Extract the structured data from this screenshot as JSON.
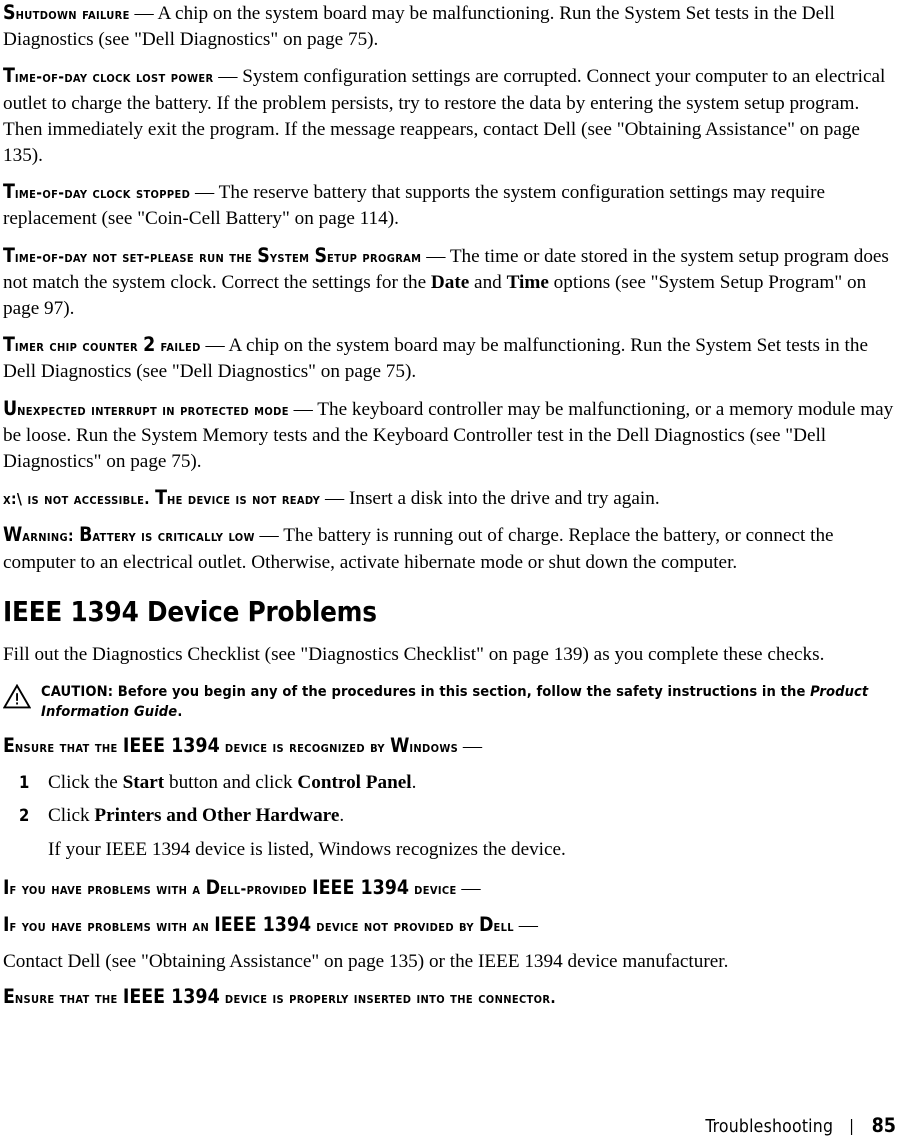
{
  "page": {
    "footer": {
      "chapter": "Troubleshooting",
      "separator": "|",
      "page_number": "85"
    }
  },
  "messages": [
    {
      "term": "Shutdown failure",
      "dash": "—",
      "body": "A chip on the system board may be malfunctioning. Run the System Set tests in the Dell Diagnostics (see \"Dell Diagnostics\" on page 75)."
    },
    {
      "term": "Time-of-day clock lost power",
      "dash": "—",
      "body": "System configuration settings are corrupted. Connect your computer to an electrical outlet to charge the battery. If the problem persists, try to restore the data by entering the system setup program. Then immediately exit the program. If the message reappears, contact Dell (see \"Obtaining Assistance\" on page 135)."
    },
    {
      "term": "Time-of-day clock stopped",
      "dash": "—",
      "body": "The reserve battery that supports the system configuration settings may require replacement (see \"Coin-Cell Battery\" on page 114)."
    },
    {
      "term": "Time-of-day not set-please run the System Setup program",
      "dash": "—",
      "body_part1": "The time or date stored in the system setup program does not match the system clock. Correct the settings for the ",
      "bold1": "Date",
      "body_part2": " and ",
      "bold2": "Time",
      "body_part3": " options (see \"System Setup Program\" on page 97)."
    },
    {
      "term": "Timer chip counter 2 failed",
      "dash": "—",
      "body": "A chip on the system board may be malfunctioning. Run the System Set tests in the Dell Diagnostics (see \"Dell Diagnostics\" on page 75)."
    },
    {
      "term": "Unexpected interrupt in protected mode",
      "dash": "—",
      "body": "The keyboard controller may be malfunctioning, or a memory module may be loose. Run the System Memory tests and the Keyboard Controller test in the Dell Diagnostics (see \"Dell Diagnostics\" on page 75)."
    },
    {
      "term": "x:\\ is not accessible. The device is not ready",
      "dash": "—",
      "body": "Insert a disk into the drive and try again."
    },
    {
      "term": "Warning: Battery is critically low",
      "dash": "—",
      "body": "The battery is running out of charge. Replace the battery, or connect the computer to an electrical outlet. Otherwise, activate hibernate mode or shut down the computer."
    }
  ],
  "section": {
    "heading": "IEEE 1394 Device Problems",
    "intro": "Fill out the Diagnostics Checklist (see \"Diagnostics Checklist\" on page 139) as you complete these checks.",
    "caution": {
      "icon": "warning-triangle-icon",
      "label": "CAUTION:",
      "text_before_italic": " Before you begin any of the procedures in this section, follow the safety instructions in the ",
      "italic_title": "Product Information Guide",
      "text_after_italic": "."
    },
    "checks": [
      {
        "term": "Ensure that the IEEE 1394 device is recognized by Windows",
        "dash": "—"
      },
      {
        "term": "If you have problems with a Dell-provided IEEE 1394 device",
        "dash": "—"
      },
      {
        "term": "If you have problems with an IEEE 1394 device not provided by Dell",
        "dash": "—"
      },
      {
        "term": "Ensure that the IEEE 1394 device is properly inserted into the connector.",
        "dash": ""
      }
    ],
    "steps": [
      {
        "number": "1",
        "text_part1": "Click the ",
        "bold1": "Start",
        "text_part2": " button and click ",
        "bold2": "Control Panel",
        "text_part3": "."
      },
      {
        "number": "2",
        "text_part1": "Click ",
        "bold1": "Printers and Other Hardware",
        "text_part2": "",
        "bold2": "",
        "text_part3": "."
      }
    ],
    "step_note": "If your IEEE 1394 device is listed, Windows recognizes the device.",
    "contact_text": "Contact Dell (see \"Obtaining Assistance\" on page 135) or the IEEE 1394 device manufacturer."
  }
}
